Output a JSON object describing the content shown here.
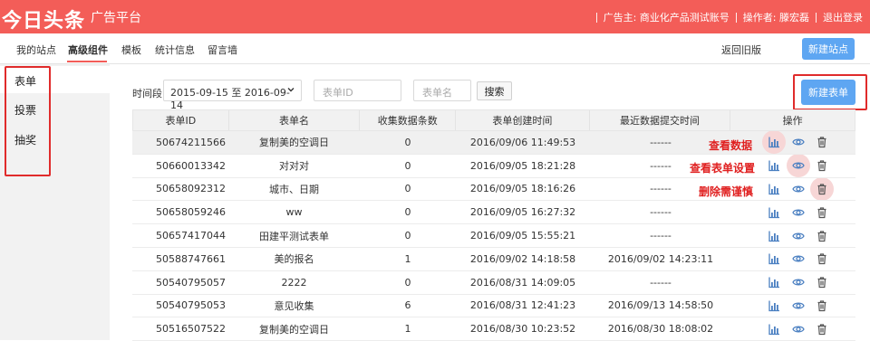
{
  "header": {
    "logo": "今日头条",
    "platform": "广告平台",
    "advertiser": "广告主: 商业化产品测试账号",
    "operator": "操作者: 滕宏磊",
    "logout": "退出登录"
  },
  "nav": {
    "tabs": [
      "我的站点",
      "高级组件",
      "模板",
      "统计信息",
      "留言墙"
    ],
    "active": "高级组件",
    "back": "返回旧版",
    "new_site": "新建站点"
  },
  "sidebar": {
    "items": [
      "表单",
      "投票",
      "抽奖"
    ],
    "active": "表单"
  },
  "filters": {
    "label": "时间段",
    "date_range": "2015-09-15 至 2016-09-14",
    "form_id_placeholder": "表单ID",
    "form_name_placeholder": "表单名",
    "search": "搜索",
    "new_form": "新建表单"
  },
  "table": {
    "headers": [
      "表单ID",
      "表单名",
      "收集数据条数",
      "表单创建时间",
      "最近数据提交时间",
      "操作"
    ],
    "rows": [
      {
        "id": "50674211566",
        "name": "复制美的空调日",
        "count": "0",
        "created": "2016/09/06 11:49:53",
        "last": "------"
      },
      {
        "id": "50660013342",
        "name": "对对对",
        "count": "0",
        "created": "2016/09/05 18:21:28",
        "last": "------"
      },
      {
        "id": "50658092312",
        "name": "城市、日期",
        "count": "0",
        "created": "2016/09/05 18:16:26",
        "last": "------"
      },
      {
        "id": "50658059246",
        "name": "ww",
        "count": "0",
        "created": "2016/09/05 16:27:32",
        "last": "------"
      },
      {
        "id": "50657417044",
        "name": "田建平测试表单",
        "count": "0",
        "created": "2016/09/05 15:55:21",
        "last": "------"
      },
      {
        "id": "50588747661",
        "name": "美的报名",
        "count": "1",
        "created": "2016/09/02 14:18:58",
        "last": "2016/09/02 14:23:11"
      },
      {
        "id": "50540795057",
        "name": "2222",
        "count": "0",
        "created": "2016/08/31 14:09:05",
        "last": "------"
      },
      {
        "id": "50540795053",
        "name": "意见收集",
        "count": "6",
        "created": "2016/08/31 12:41:23",
        "last": "2016/09/13 14:58:50"
      },
      {
        "id": "50516507522",
        "name": "复制美的空调日",
        "count": "1",
        "created": "2016/08/30 10:23:52",
        "last": "2016/08/30 18:08:02"
      }
    ]
  },
  "annotations": {
    "view_data": "查看数据",
    "view_settings": "查看表单设置",
    "delete_caution": "删除需谨慎"
  },
  "colors": {
    "brand": "#f35d58",
    "primary_button": "#5ea6f2",
    "annotation": "#e02020"
  }
}
